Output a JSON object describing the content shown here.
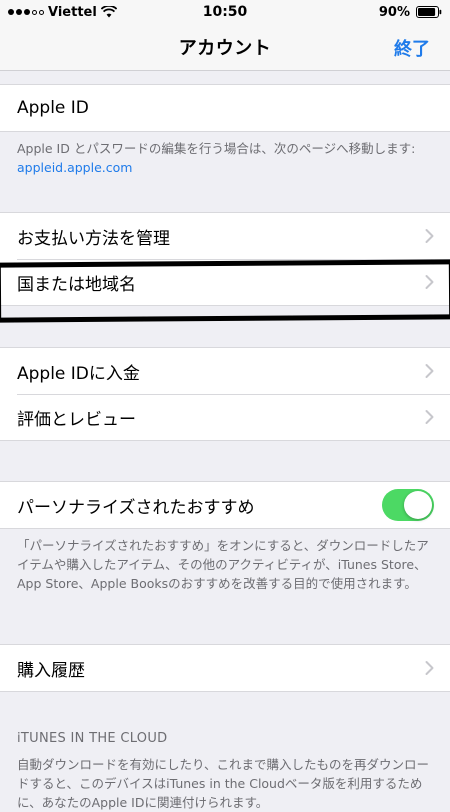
{
  "status_bar": {
    "carrier": "Viettel",
    "time": "10:50",
    "battery": "90%",
    "battery_level": 0.9
  },
  "nav": {
    "title": "アカウント",
    "done_label": "終了"
  },
  "apple_id_section": {
    "row_label": "Apple ID",
    "footer_prefix": "Apple ID とパスワードの編集を行う場合は、次のページへ移動します: ",
    "footer_link": "appleid.apple.com"
  },
  "payment_section": {
    "items": [
      {
        "label": "お支払い方法を管理"
      },
      {
        "label": "国または地域名"
      }
    ]
  },
  "funds_section": {
    "items": [
      {
        "label": "Apple IDに入金"
      },
      {
        "label": "評価とレビュー"
      }
    ]
  },
  "personalized_section": {
    "row_label": "パーソナライズされたおすすめ",
    "toggle_on": true,
    "footer": "「パーソナライズされたおすすめ」をオンにすると、ダウンロードしたアイテムや購入したアイテム、その他のアクティビティが、iTunes Store、App Store、Apple Booksのおすすめを改善する目的で使用されます。"
  },
  "history_section": {
    "row_label": "購入履歴"
  },
  "cloud_section": {
    "header": "iTUNES IN THE CLOUD",
    "footer": "自動ダウンロードを有効にしたり、これまで購入したものを再ダウンロードすると、このデバイスはiTunes in the Cloudベータ版を利用するために、あなたのApple IDに関連付けられます。"
  },
  "colors": {
    "accent": "#1f7bea",
    "toggle_on": "#4cd964",
    "background": "#efeff4"
  },
  "icons": {
    "wifi": "wifi-icon",
    "battery": "battery-icon",
    "chevron": "chevron-right-icon"
  }
}
